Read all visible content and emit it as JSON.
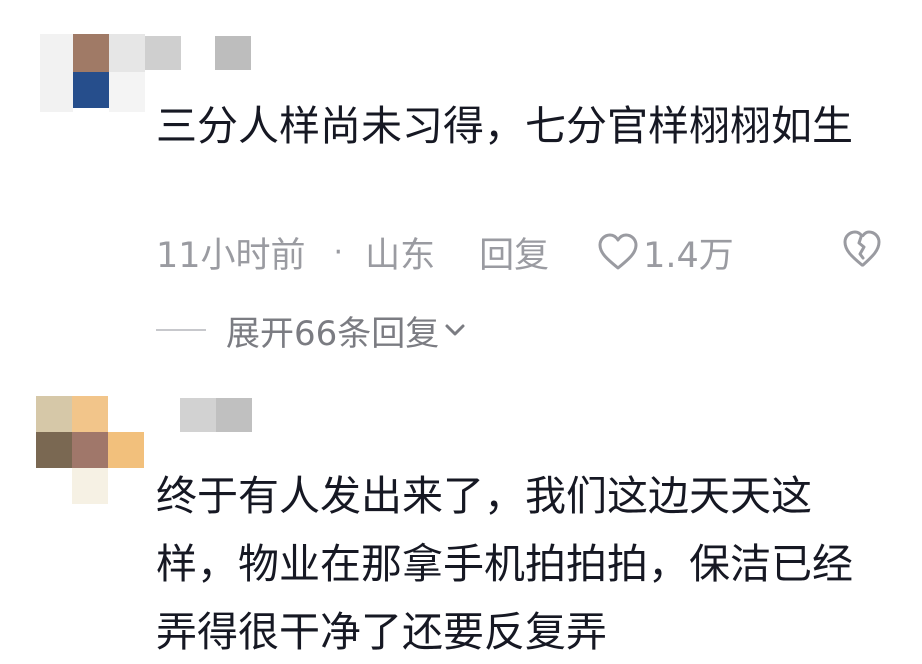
{
  "comments": [
    {
      "text": "三分人样尚未习得，七分官样栩栩如生",
      "time": "11小时前",
      "separator": "·",
      "location": "山东",
      "reply_label": "回复",
      "likes": "1.4万",
      "expand_label": "展开66条回复",
      "icons": [
        "heart-icon",
        "broken-heart-icon",
        "chevron-down-icon"
      ]
    },
    {
      "text": "终于有人发出来了，我们这边天天这样，物业在那拿手机拍拍拍，保洁已经弄得很干净了还要反复弄"
    }
  ],
  "colors": {
    "text": "#161823",
    "meta": "#9a9ba1",
    "expand": "#7b7c82"
  }
}
